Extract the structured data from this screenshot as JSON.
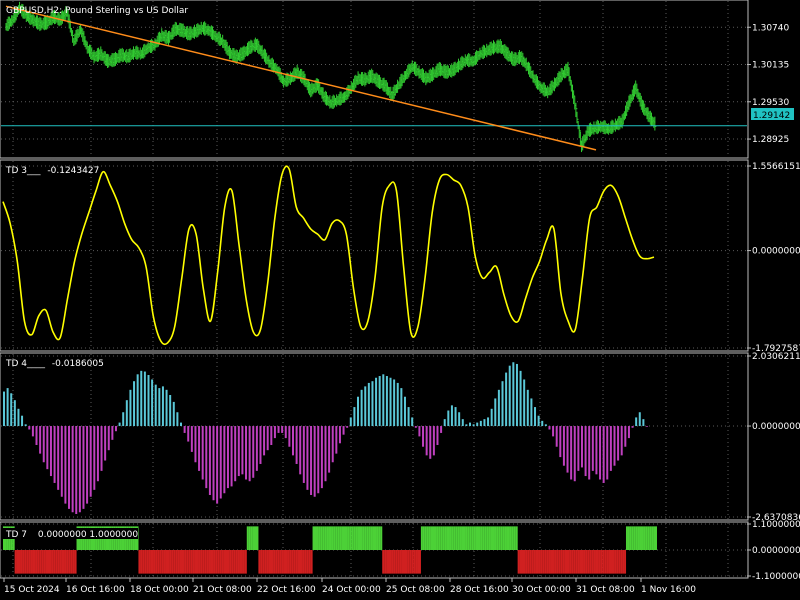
{
  "colors": {
    "background": "#000000",
    "grid": "#5a5a5a",
    "frame": "#bcbcbc",
    "price_line": "#32cd32",
    "trend_line": "#ff8c1a",
    "bid_line": "#20c2c2",
    "td3_line": "#ffff00",
    "td4_pos": "#5bc8d8",
    "td4_neg": "#c040c0",
    "td7_pos": "#4cd137",
    "td7_neg": "#d02020"
  },
  "chart_data": [
    {
      "type": "line",
      "title": "GBPUSD,H2: Pound Sterling vs US Dollar",
      "ylim": [
        1.2865,
        1.3115
      ],
      "yticks": [
        "1.30740",
        "1.30135",
        "1.29530",
        "1.28925"
      ],
      "current_price": "1.29142",
      "current_price_value": 1.29142,
      "trendline": [
        [
          0,
          1.3108
        ],
        [
          96,
          1.2875
        ]
      ],
      "series": [
        {
          "values": [
            1.3075,
            1.3085,
            1.3105,
            1.3092,
            1.3085,
            1.3078,
            1.308,
            1.309,
            1.3085,
            1.3098,
            1.305,
            1.307,
            1.304,
            1.3025,
            1.303,
            1.3018,
            1.302,
            1.3028,
            1.3025,
            1.3032,
            1.303,
            1.304,
            1.3045,
            1.306,
            1.3055,
            1.307,
            1.3068,
            1.3062,
            1.3066,
            1.3072,
            1.3068,
            1.3058,
            1.305,
            1.3032,
            1.3025,
            1.303,
            1.304,
            1.3045,
            1.303,
            1.3015,
            1.3005,
            1.2985,
            1.299,
            1.3,
            1.299,
            1.297,
            1.298,
            1.296,
            1.295,
            1.2955,
            1.296,
            1.2975,
            1.299,
            1.2988,
            1.2994,
            1.2985,
            1.2978,
            1.2962,
            1.298,
            1.2995,
            1.301,
            1.3,
            1.299,
            1.2996,
            1.3005,
            1.3,
            1.3003,
            1.3012,
            1.302,
            1.3018,
            1.303,
            1.3035,
            1.304,
            1.3042,
            1.303,
            1.302,
            1.3025,
            1.301,
            1.299,
            1.2975,
            1.2968,
            1.298,
            1.2995,
            1.3005,
            1.295,
            1.288,
            1.2905,
            1.291,
            1.2912,
            1.2908,
            1.2914,
            1.292,
            1.295,
            1.2975,
            1.2945,
            1.2928,
            1.2914
          ]
        }
      ]
    },
    {
      "type": "line",
      "title": "TD 3___",
      "value_label": "-0.1243427",
      "ylim": [
        -1.7927587,
        1.5566151
      ],
      "yticks": [
        "1.5566151",
        "0.0000000",
        "-1.7927587"
      ],
      "series": [
        {
          "values": [
            0.9,
            0.5,
            -0.2,
            -1.3,
            -1.55,
            -1.2,
            -1.1,
            -1.5,
            -1.6,
            -0.9,
            -0.2,
            0.3,
            0.7,
            1.1,
            1.45,
            1.2,
            0.9,
            0.5,
            0.2,
            0.05,
            -0.3,
            -1.2,
            -1.65,
            -1.7,
            -1.4,
            -0.5,
            0.4,
            0.3,
            -0.7,
            -1.3,
            -0.4,
            0.8,
            1.1,
            0.1,
            -0.9,
            -1.5,
            -1.45,
            -0.6,
            0.6,
            1.4,
            1.5,
            0.8,
            0.6,
            0.4,
            0.3,
            0.2,
            0.5,
            0.55,
            0.3,
            -0.7,
            -1.4,
            -1.3,
            -0.5,
            0.8,
            1.2,
            1.1,
            -0.3,
            -1.5,
            -1.4,
            -0.5,
            0.7,
            1.3,
            1.4,
            1.3,
            1.2,
            0.8,
            -0.1,
            -0.5,
            -0.4,
            -0.3,
            -0.8,
            -1.2,
            -1.3,
            -0.9,
            -0.5,
            -0.2,
            0.2,
            0.4,
            -0.8,
            -1.3,
            -1.45,
            -0.5,
            0.6,
            0.8,
            1.1,
            1.2,
            1.0,
            0.6,
            0.2,
            -0.1,
            -0.15,
            -0.12
          ]
        }
      ]
    },
    {
      "type": "bar",
      "title": "TD 4____",
      "value_label": "-0.0186005",
      "ylim": [
        -2.6370836,
        2.0306211
      ],
      "yticks": [
        "2.0306211",
        "0.0000000",
        "-2.6370836"
      ],
      "series": [
        {
          "values": [
            1.0,
            1.1,
            0.95,
            0.75,
            0.5,
            0.3,
            0.05,
            -0.1,
            -0.3,
            -0.55,
            -0.8,
            -1.05,
            -1.25,
            -1.45,
            -1.65,
            -1.85,
            -2.05,
            -2.25,
            -2.4,
            -2.5,
            -2.55,
            -2.5,
            -2.4,
            -2.25,
            -2.05,
            -1.85,
            -1.6,
            -1.3,
            -1.0,
            -0.7,
            -0.4,
            -0.15,
            0.1,
            0.4,
            0.75,
            1.05,
            1.3,
            1.5,
            1.6,
            1.58,
            1.48,
            1.35,
            1.2,
            1.1,
            1.15,
            1.05,
            0.9,
            0.7,
            0.4,
            0.1,
            -0.2,
            -0.45,
            -0.75,
            -1.05,
            -1.3,
            -1.55,
            -1.8,
            -2.0,
            -2.15,
            -2.25,
            -2.1,
            -1.95,
            -1.8,
            -1.75,
            -1.6,
            -1.45,
            -1.4,
            -1.55,
            -1.6,
            -1.5,
            -1.3,
            -1.1,
            -0.85,
            -0.7,
            -0.55,
            -0.35,
            -0.2,
            -0.2,
            -0.35,
            -0.6,
            -0.85,
            -1.1,
            -1.4,
            -1.65,
            -1.85,
            -2.0,
            -2.05,
            -1.95,
            -1.8,
            -1.6,
            -1.35,
            -1.05,
            -0.8,
            -0.5,
            -0.25,
            -0.05,
            0.25,
            0.55,
            0.85,
            1.05,
            1.15,
            1.25,
            1.3,
            1.4,
            1.45,
            1.5,
            1.45,
            1.4,
            1.35,
            1.25,
            1.1,
            0.85,
            0.55,
            0.25,
            -0.05,
            -0.3,
            -0.6,
            -0.85,
            -0.95,
            -0.85,
            -0.55,
            -0.2,
            0.2,
            0.45,
            0.6,
            0.55,
            0.4,
            0.2,
            0.05,
            0.1,
            0.05,
            0.1,
            0.15,
            0.2,
            0.25,
            0.5,
            0.8,
            1.05,
            1.3,
            1.55,
            1.75,
            1.85,
            1.8,
            1.6,
            1.35,
            1.05,
            0.8,
            0.55,
            0.3,
            0.15,
            0.05,
            -0.1,
            -0.3,
            -0.6,
            -0.9,
            -1.15,
            -1.35,
            -1.55,
            -1.6,
            -1.3,
            -1.2,
            -1.45,
            -1.55,
            -1.3,
            -1.4,
            -1.55,
            -1.65,
            -1.55,
            -1.3,
            -1.15,
            -1.0,
            -0.85,
            -0.6,
            -0.35,
            -0.05,
            0.25,
            0.4,
            0.2,
            -0.02
          ]
        }
      ]
    },
    {
      "type": "bar",
      "title": "TD 7",
      "value_label": "0.0000000 1.0000000",
      "ylim": [
        -1.1,
        1.1
      ],
      "yticks": [
        "1.1000000",
        "0.0000000",
        "-1.1000000"
      ],
      "segments": [
        {
          "value": 1,
          "count": 6
        },
        {
          "value": -1,
          "count": 32
        },
        {
          "value": 1,
          "count": 32
        },
        {
          "value": -1,
          "count": 56
        },
        {
          "value": 1,
          "count": 6
        },
        {
          "value": -1,
          "count": 28
        },
        {
          "value": 1,
          "count": 36
        },
        {
          "value": -1,
          "count": 20
        },
        {
          "value": 1,
          "count": 50
        },
        {
          "value": -1,
          "count": 56
        },
        {
          "value": 1,
          "count": 16
        }
      ]
    }
  ],
  "x_axis": {
    "labels": [
      "15 Oct 2024",
      "16 Oct 16:00",
      "18 Oct 00:00",
      "21 Oct 08:00",
      "22 Oct 16:00",
      "24 Oct 00:00",
      "25 Oct 08:00",
      "28 Oct 16:00",
      "30 Oct 00:00",
      "31 Oct 08:00",
      "1 Nov 16:00"
    ]
  }
}
